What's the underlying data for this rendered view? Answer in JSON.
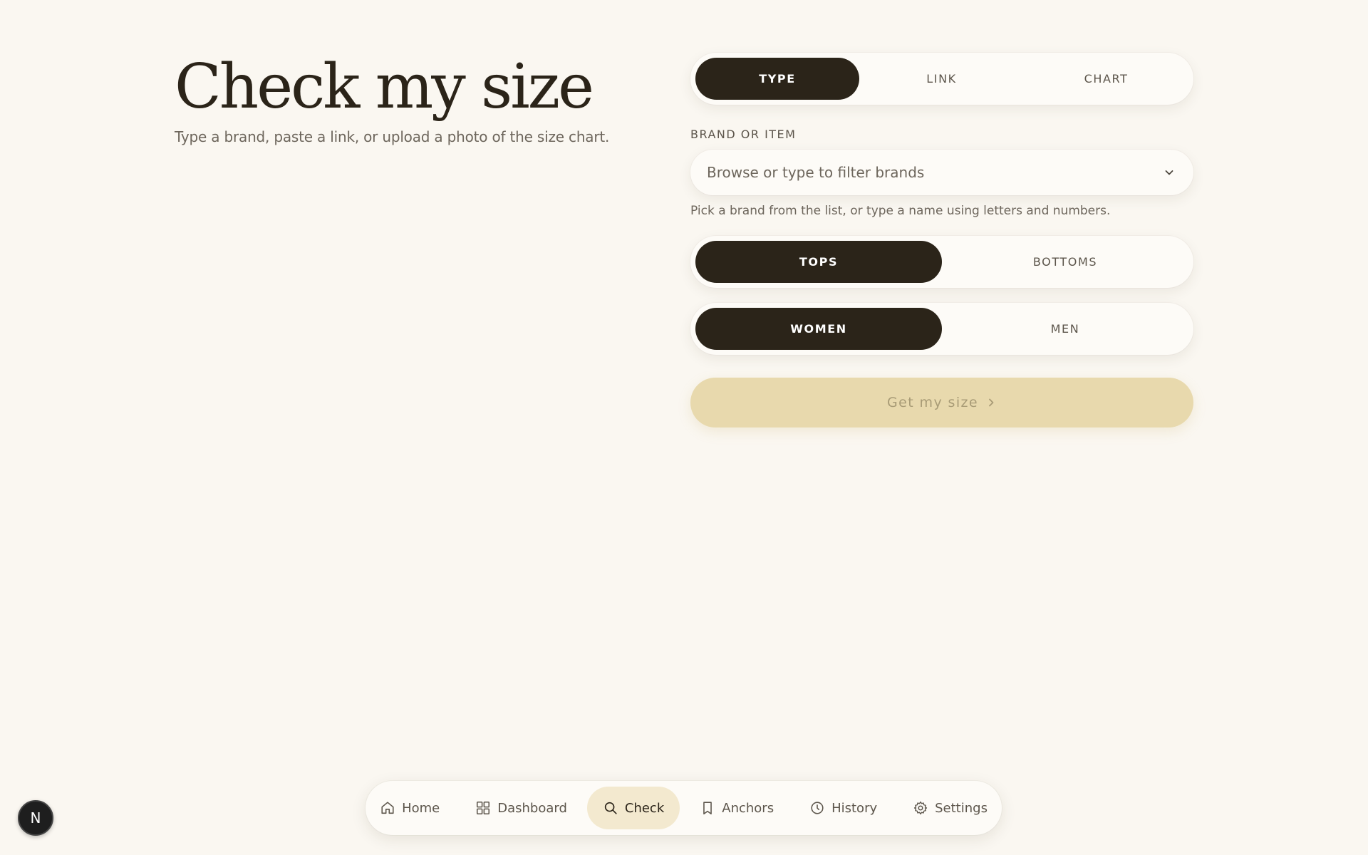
{
  "header": {
    "title": "Check my size",
    "subtitle": "Type a brand, paste a link, or upload a photo of the size chart."
  },
  "mode_tabs": {
    "items": [
      {
        "label": "TYPE",
        "active": true
      },
      {
        "label": "LINK",
        "active": false
      },
      {
        "label": "CHART",
        "active": false
      }
    ]
  },
  "brand_field": {
    "label": "BRAND OR ITEM",
    "placeholder": "Browse or type to filter brands",
    "help": "Pick a brand from the list, or type a name using letters and numbers."
  },
  "category_tabs": {
    "items": [
      {
        "label": "TOPS",
        "active": true
      },
      {
        "label": "BOTTOMS",
        "active": false
      }
    ]
  },
  "gender_tabs": {
    "items": [
      {
        "label": "WOMEN",
        "active": true
      },
      {
        "label": "MEN",
        "active": false
      }
    ]
  },
  "cta": {
    "label": "Get my size"
  },
  "nav": {
    "items": [
      {
        "label": "Home",
        "icon": "home-icon"
      },
      {
        "label": "Dashboard",
        "icon": "grid-icon"
      },
      {
        "label": "Check",
        "icon": "search-icon",
        "active": true
      },
      {
        "label": "Anchors",
        "icon": "bookmark-icon"
      },
      {
        "label": "History",
        "icon": "clock-icon"
      },
      {
        "label": "Settings",
        "icon": "gear-icon"
      }
    ]
  },
  "badge": {
    "letter": "N"
  },
  "colors": {
    "background": "#faf7f1",
    "ink": "#2b2419",
    "accent": "#e8d9ad",
    "nav_active": "#f3e9cf"
  }
}
